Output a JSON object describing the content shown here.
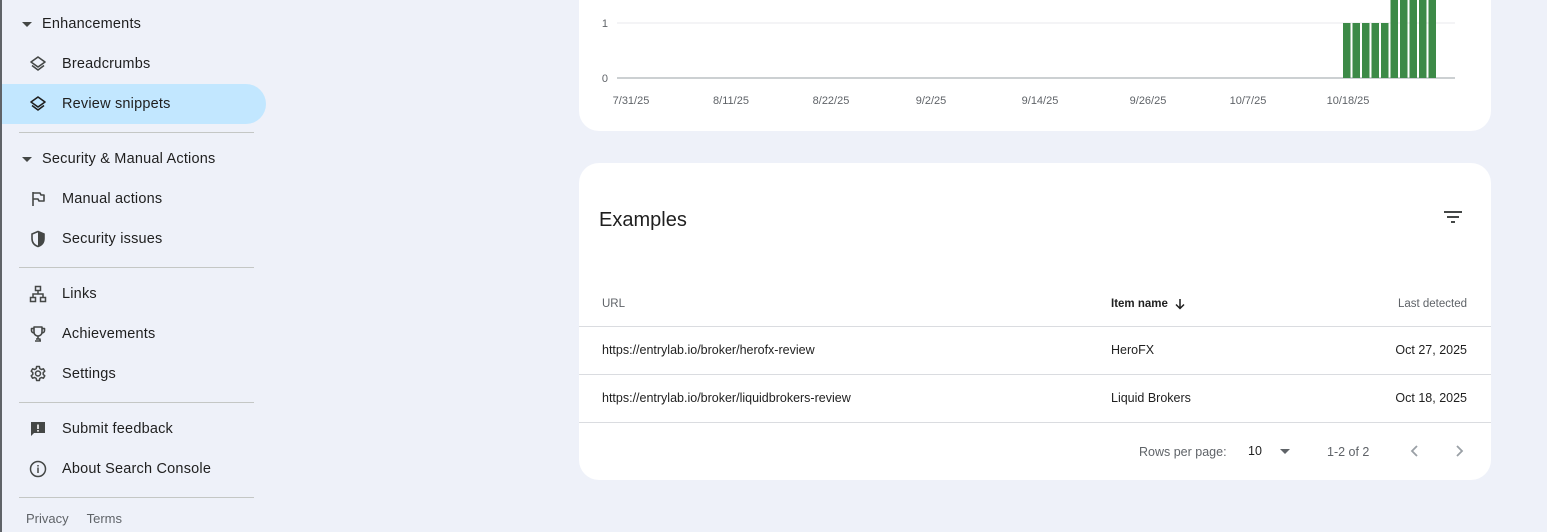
{
  "sidebar": {
    "enhancements_header": "Enhancements",
    "security_header": "Security & Manual Actions",
    "items": {
      "breadcrumbs": "Breadcrumbs",
      "review_snippets": "Review snippets",
      "manual_actions": "Manual actions",
      "security_issues": "Security issues",
      "links": "Links",
      "achievements": "Achievements",
      "settings": "Settings",
      "submit_feedback": "Submit feedback",
      "about": "About Search Console"
    },
    "footer": {
      "privacy": "Privacy",
      "terms": "Terms"
    }
  },
  "chart_data": {
    "type": "bar",
    "y_ticks": [
      "0",
      "1"
    ],
    "x_ticks": [
      "7/31/25",
      "8/11/25",
      "8/22/25",
      "9/2/25",
      "9/14/25",
      "9/26/25",
      "10/7/25",
      "10/18/25"
    ],
    "bar_color": "#3c8a47",
    "series": [
      {
        "values": [
          1,
          1,
          1,
          1,
          1,
          2,
          2,
          2,
          2,
          2
        ]
      }
    ]
  },
  "examples": {
    "title": "Examples",
    "columns": {
      "url": "URL",
      "item_name": "Item name",
      "last_detected": "Last detected"
    },
    "rows": [
      {
        "url": "https://entrylab.io/broker/herofx-review",
        "item_name": "HeroFX",
        "last_detected": "Oct 27, 2025"
      },
      {
        "url": "https://entrylab.io/broker/liquidbrokers-review",
        "item_name": "Liquid Brokers",
        "last_detected": "Oct 18, 2025"
      }
    ],
    "pagination": {
      "rows_per_page_label": "Rows per page:",
      "rows_per_page_value": "10",
      "range": "1-2 of 2"
    }
  }
}
